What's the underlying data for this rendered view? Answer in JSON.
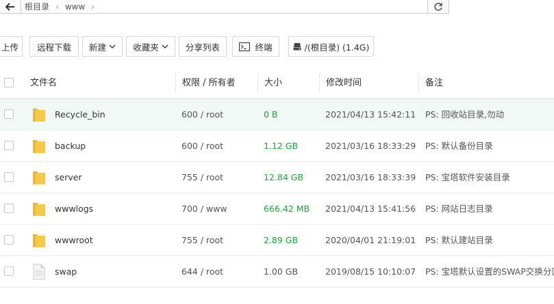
{
  "pathbar": {
    "crumbs": [
      "根目录",
      "www"
    ]
  },
  "toolbar": {
    "upload": "上传",
    "remote_download": "远程下载",
    "new": "新建",
    "favorites": "收藏夹",
    "share_list": "分享列表",
    "terminal": "终端",
    "disk": "/(根目录) (1.4G)"
  },
  "table": {
    "headers": {
      "name": "文件名",
      "perm": "权限 / 所有者",
      "size": "大小",
      "mtime": "修改时间",
      "note": "备注"
    },
    "rows": [
      {
        "name": "Recycle_bin",
        "perm": "600 / root",
        "size": "0 B",
        "mtime": "2021/04/13 15:42:11",
        "note": "PS: 回收站目录,勿动",
        "type": "folder-icon"
      },
      {
        "name": "backup",
        "perm": "600 / root",
        "size": "1.12 GB",
        "mtime": "2021/03/16 18:33:29",
        "note": "PS: 默认备份目录",
        "type": "folder-icon"
      },
      {
        "name": "server",
        "perm": "755 / root",
        "size": "12.84 GB",
        "mtime": "2021/03/16 18:33:39",
        "note": "PS: 宝塔软件安装目录",
        "type": "folder-icon"
      },
      {
        "name": "wwwlogs",
        "perm": "700 / www",
        "size": "666.42 MB",
        "mtime": "2021/04/13 15:41:56",
        "note": "PS: 网站日志目录",
        "type": "folder-icon"
      },
      {
        "name": "wwwroot",
        "perm": "755 / root",
        "size": "2.89 GB",
        "mtime": "2020/04/01 21:19:01",
        "note": "PS: 默认建站目录",
        "type": "folder-icon"
      },
      {
        "name": "swap",
        "perm": "644 / root",
        "size": "1.00 GB",
        "mtime": "2019/08/15 10:10:07",
        "note": "PS: 宝塔默认设置的SWAP交换分区...",
        "type": "file-icon"
      }
    ]
  },
  "colors": {
    "size_green": "#20a53a",
    "folder_yellow": "#f7c948",
    "row_highlight": "#f1f8f5"
  }
}
